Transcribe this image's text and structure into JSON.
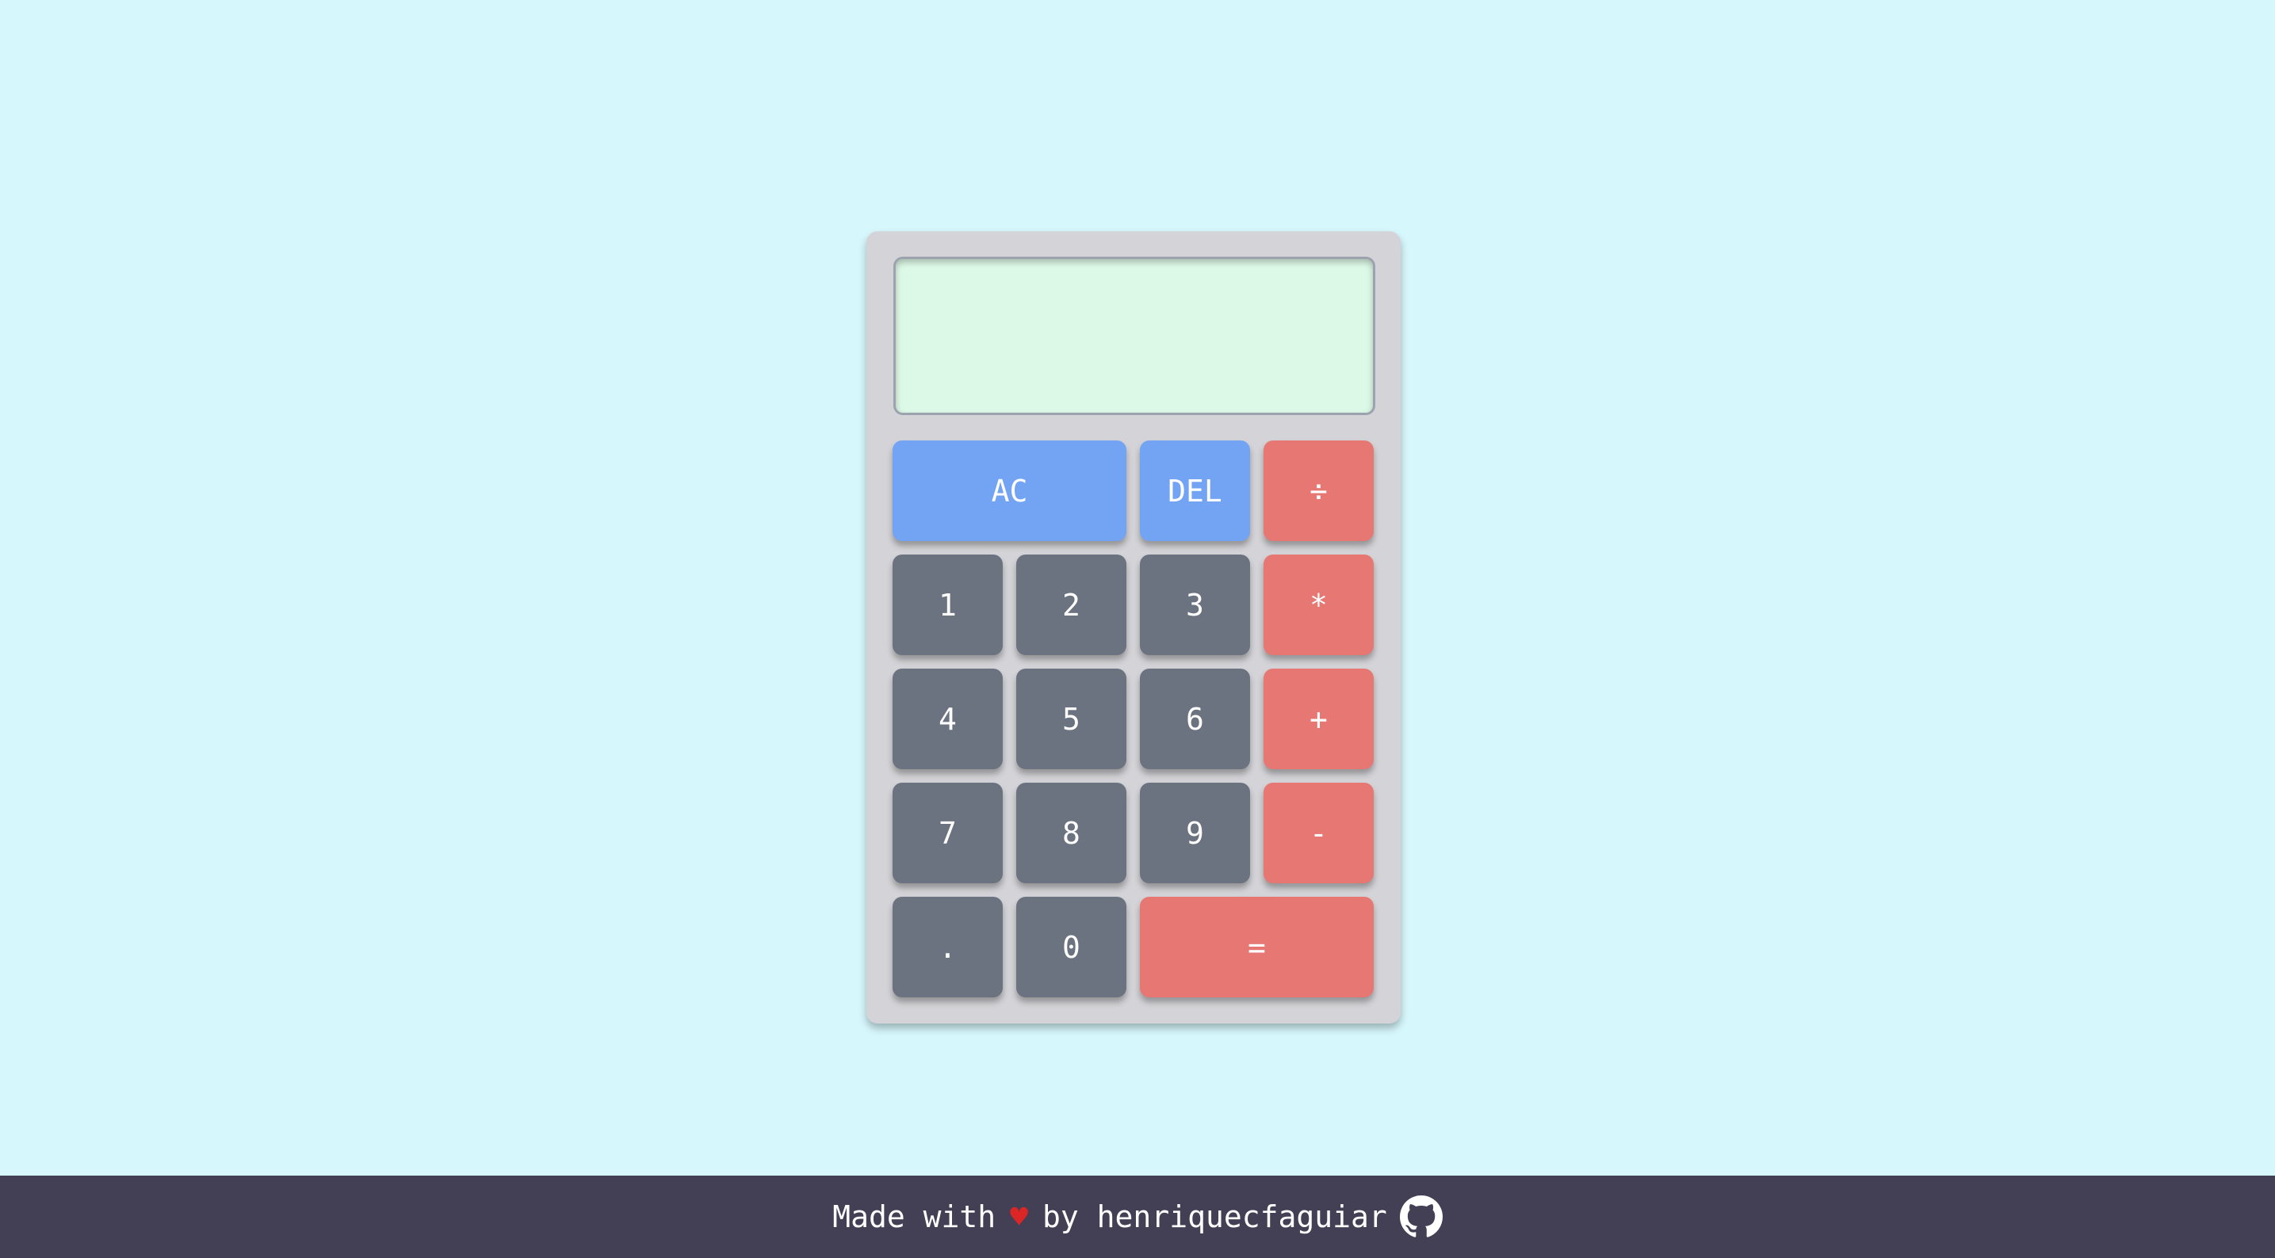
{
  "display": {
    "value": ""
  },
  "keys": {
    "ac": "AC",
    "del": "DEL",
    "divide": "÷",
    "one": "1",
    "two": "2",
    "three": "3",
    "multiply": "*",
    "four": "4",
    "five": "5",
    "six": "6",
    "plus": "+",
    "seven": "7",
    "eight": "8",
    "nine": "9",
    "minus": "-",
    "dot": ".",
    "zero": "0",
    "equals": "="
  },
  "footer": {
    "made_with": "Made with",
    "heart": "♥",
    "by": "by henriquecfaguiar",
    "icon": "github-icon"
  },
  "colors": {
    "background": "#d6f7fc",
    "display": "#dcf8e6",
    "number_key": "#6b7280",
    "function_key": "#73a3f3",
    "operator_key": "#e67773",
    "footer": "#433f55"
  }
}
